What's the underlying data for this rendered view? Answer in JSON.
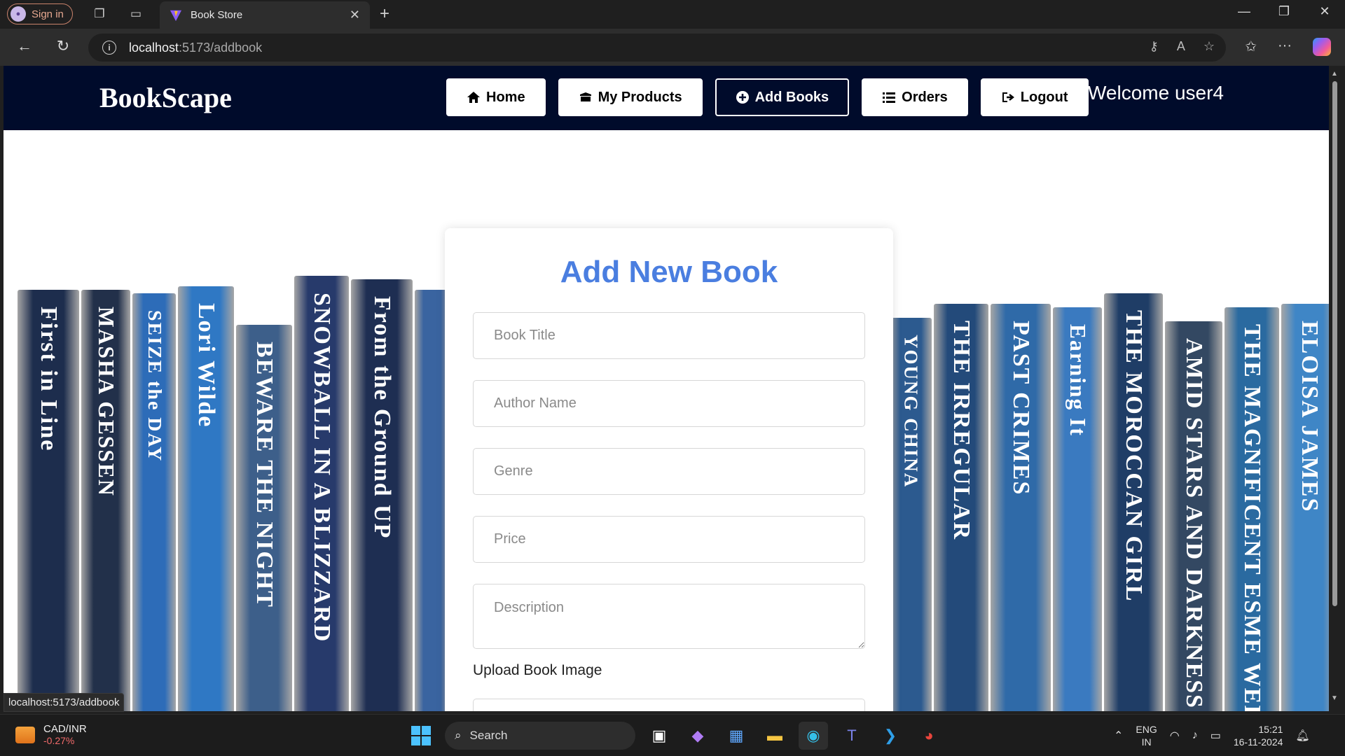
{
  "browser": {
    "profile_label": "Sign in",
    "tab_title": "Book Store",
    "url_host": "localhost",
    "url_path": ":5173/addbook"
  },
  "site": {
    "brand": "BookScape",
    "nav": [
      {
        "label": "Home",
        "icon": "home-icon"
      },
      {
        "label": "My Products",
        "icon": "box-icon"
      },
      {
        "label": "Add Books",
        "icon": "plus-circle-icon",
        "active": true
      },
      {
        "label": "Orders",
        "icon": "list-icon"
      },
      {
        "label": "Logout",
        "icon": "logout-icon"
      }
    ],
    "welcome": "Welcome user4",
    "colors": {
      "nav_bg": "#000b2b",
      "title": "#4a7ee0"
    }
  },
  "form": {
    "title": "Add New Book",
    "book_title_placeholder": "Book Title",
    "author_placeholder": "Author Name",
    "genre_placeholder": "Genre",
    "price_placeholder": "Price",
    "description_placeholder": "Description",
    "upload_label": "Upload Book Image"
  },
  "books_left": [
    {
      "title": "First in Line",
      "color": "#1d2d4d"
    },
    {
      "title": "MASHA GESSEN",
      "color": "#22304a"
    },
    {
      "title": "SEIZE the DAY",
      "color": "#2d6cb8"
    },
    {
      "title": "Lori Wilde",
      "color": "#2f78c4"
    },
    {
      "title": "BEWARE THE NIGHT",
      "color": "#3d5f8a"
    },
    {
      "title": "SNOWBALL IN A BLIZZARD",
      "color": "#273a6b"
    },
    {
      "title": "From the Ground UP",
      "color": "#1e2e52"
    },
    {
      "title": "",
      "color": "#3a64a0"
    }
  ],
  "books_right": [
    {
      "title": "YOUNG CHINA",
      "color": "#2c5a8f"
    },
    {
      "title": "THE IRREGULAR",
      "color": "#234a7a"
    },
    {
      "title": "PAST CRIMES",
      "color": "#2f6aa8"
    },
    {
      "title": "Earning It",
      "color": "#3a7ac0"
    },
    {
      "title": "THE MOROCCAN GIRL",
      "color": "#1f3d66"
    },
    {
      "title": "AMID STARS AND DARKNESS",
      "color": "#334862"
    },
    {
      "title": "THE MAGNIFICENT ESME WELLS",
      "color": "#2a6aa0"
    },
    {
      "title": "ELOISA JAMES",
      "color": "#3f86c6"
    }
  ],
  "status_url": "localhost:5173/addbook",
  "taskbar": {
    "widget_title": "CAD/INR",
    "widget_value": "-0.27%",
    "search_label": "Search",
    "lang_top": "ENG",
    "lang_bottom": "IN",
    "time": "15:21",
    "date": "16-11-2024"
  }
}
